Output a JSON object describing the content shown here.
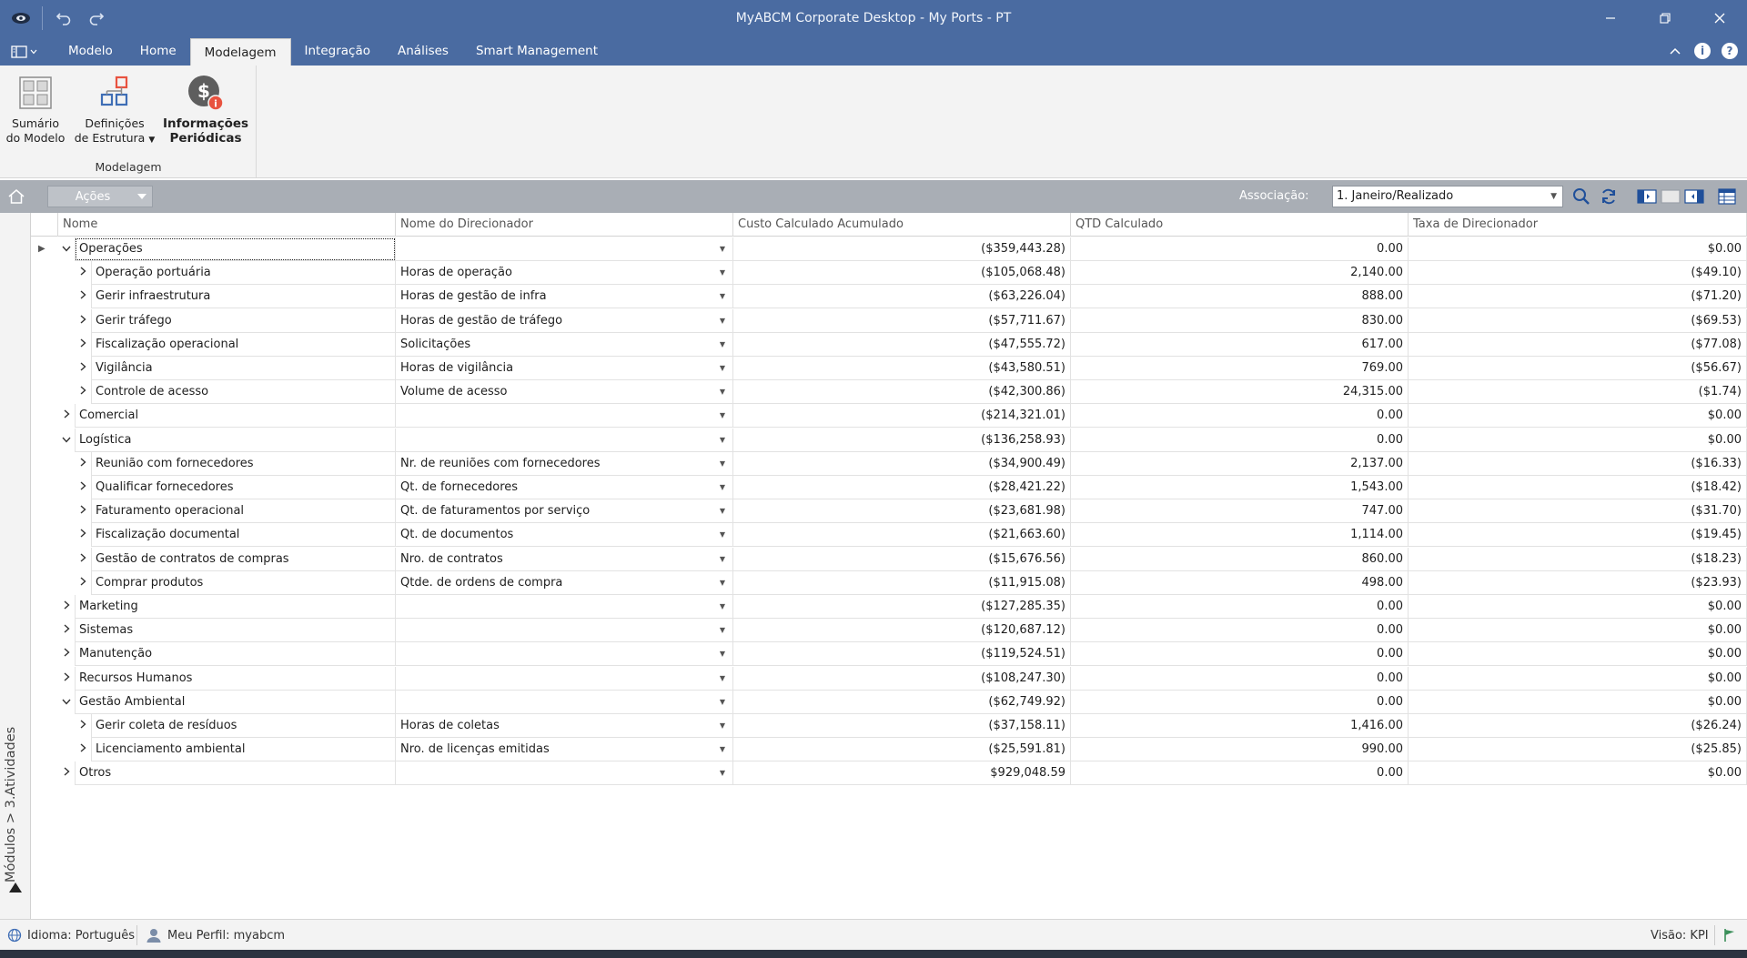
{
  "window": {
    "title": "MyABCM Corporate Desktop - My Ports - PT",
    "controls": [
      "minimize-icon",
      "restore-icon",
      "close-icon"
    ]
  },
  "menu": {
    "tabs": [
      "Modelo",
      "Home",
      "Modelagem",
      "Integração",
      "Análises",
      "Smart Management"
    ],
    "active_tab": "Modelagem"
  },
  "ribbon": {
    "buttons": [
      {
        "line1": "Sumário",
        "line2": "do Modelo"
      },
      {
        "line1": "Definições",
        "line2": "de Estrutura"
      },
      {
        "line1": "Informações",
        "line2": "Periódicas"
      }
    ],
    "group_label": "Modelagem"
  },
  "toolbar": {
    "acoes_label": "Ações",
    "assoc_label": "Associação:",
    "assoc_value": "1. Janeiro/Realizado"
  },
  "side_panel": {
    "label": "Módulos > 3.Atividades"
  },
  "grid": {
    "columns": [
      "Nome",
      "Nome do Direcionador",
      "Custo Calculado Acumulado",
      "QTD Calculado",
      "Taxa de Direcionador"
    ],
    "rows": [
      {
        "level": 0,
        "expanded": true,
        "name": "Operações",
        "driver": "",
        "cost": "($359,443.28)",
        "qty": "0.00",
        "rate": "$0.00"
      },
      {
        "level": 1,
        "expanded": false,
        "name": "Operação portuária",
        "driver": "Horas de operação",
        "cost": "($105,068.48)",
        "qty": "2,140.00",
        "rate": "($49.10)"
      },
      {
        "level": 1,
        "expanded": false,
        "name": "Gerir infraestrutura",
        "driver": "Horas de gestão de infra",
        "cost": "($63,226.04)",
        "qty": "888.00",
        "rate": "($71.20)"
      },
      {
        "level": 1,
        "expanded": false,
        "name": "Gerir tráfego",
        "driver": "Horas de gestão de tráfego",
        "cost": "($57,711.67)",
        "qty": "830.00",
        "rate": "($69.53)"
      },
      {
        "level": 1,
        "expanded": false,
        "name": "Fiscalização operacional",
        "driver": "Solicitações",
        "cost": "($47,555.72)",
        "qty": "617.00",
        "rate": "($77.08)"
      },
      {
        "level": 1,
        "expanded": false,
        "name": "Vigilância",
        "driver": "Horas de vigilância",
        "cost": "($43,580.51)",
        "qty": "769.00",
        "rate": "($56.67)"
      },
      {
        "level": 1,
        "expanded": false,
        "name": "Controle de acesso",
        "driver": "Volume de acesso",
        "cost": "($42,300.86)",
        "qty": "24,315.00",
        "rate": "($1.74)"
      },
      {
        "level": 0,
        "expanded": false,
        "name": "Comercial",
        "driver": "",
        "cost": "($214,321.01)",
        "qty": "0.00",
        "rate": "$0.00"
      },
      {
        "level": 0,
        "expanded": true,
        "name": "Logística",
        "driver": "",
        "cost": "($136,258.93)",
        "qty": "0.00",
        "rate": "$0.00"
      },
      {
        "level": 1,
        "expanded": false,
        "name": "Reunião com fornecedores",
        "driver": "Nr. de reuniões com fornecedores",
        "cost": "($34,900.49)",
        "qty": "2,137.00",
        "rate": "($16.33)"
      },
      {
        "level": 1,
        "expanded": false,
        "name": "Qualificar fornecedores",
        "driver": "Qt. de fornecedores",
        "cost": "($28,421.22)",
        "qty": "1,543.00",
        "rate": "($18.42)"
      },
      {
        "level": 1,
        "expanded": false,
        "name": "Faturamento operacional",
        "driver": "Qt. de faturamentos por serviço",
        "cost": "($23,681.98)",
        "qty": "747.00",
        "rate": "($31.70)"
      },
      {
        "level": 1,
        "expanded": false,
        "name": "Fiscalização documental",
        "driver": "Qt. de documentos",
        "cost": "($21,663.60)",
        "qty": "1,114.00",
        "rate": "($19.45)"
      },
      {
        "level": 1,
        "expanded": false,
        "name": "Gestão de contratos de compras",
        "driver": "Nro. de contratos",
        "cost": "($15,676.56)",
        "qty": "860.00",
        "rate": "($18.23)"
      },
      {
        "level": 1,
        "expanded": false,
        "name": "Comprar produtos",
        "driver": "Qtde. de ordens de compra",
        "cost": "($11,915.08)",
        "qty": "498.00",
        "rate": "($23.93)"
      },
      {
        "level": 0,
        "expanded": false,
        "name": "Marketing",
        "driver": "",
        "cost": "($127,285.35)",
        "qty": "0.00",
        "rate": "$0.00"
      },
      {
        "level": 0,
        "expanded": false,
        "name": "Sistemas",
        "driver": "",
        "cost": "($120,687.12)",
        "qty": "0.00",
        "rate": "$0.00"
      },
      {
        "level": 0,
        "expanded": false,
        "name": "Manutenção",
        "driver": "",
        "cost": "($119,524.51)",
        "qty": "0.00",
        "rate": "$0.00"
      },
      {
        "level": 0,
        "expanded": false,
        "name": "Recursos Humanos",
        "driver": "",
        "cost": "($108,247.30)",
        "qty": "0.00",
        "rate": "$0.00"
      },
      {
        "level": 0,
        "expanded": true,
        "name": "Gestão Ambiental",
        "driver": "",
        "cost": "($62,749.92)",
        "qty": "0.00",
        "rate": "$0.00"
      },
      {
        "level": 1,
        "expanded": false,
        "name": "Gerir coleta de resíduos",
        "driver": "Horas de coletas",
        "cost": "($37,158.11)",
        "qty": "1,416.00",
        "rate": "($26.24)"
      },
      {
        "level": 1,
        "expanded": false,
        "name": "Licenciamento ambiental",
        "driver": "Nro. de licenças emitidas",
        "cost": "($25,591.81)",
        "qty": "990.00",
        "rate": "($25.85)"
      },
      {
        "level": 0,
        "expanded": false,
        "name": "Otros",
        "driver": "",
        "cost": "$929,048.59",
        "qty": "0.00",
        "rate": "$0.00"
      }
    ]
  },
  "status": {
    "language": "Idioma: Português",
    "profile": "Meu Perfil: myabcm",
    "view": "Visão: KPI"
  },
  "colors": {
    "titlebar": "#4a6ba1",
    "toolbar": "#a9aeb5",
    "ribbon_bg": "#f3f3f3",
    "accent_red": "#e8523f",
    "accent_blue": "#3e6db5"
  }
}
